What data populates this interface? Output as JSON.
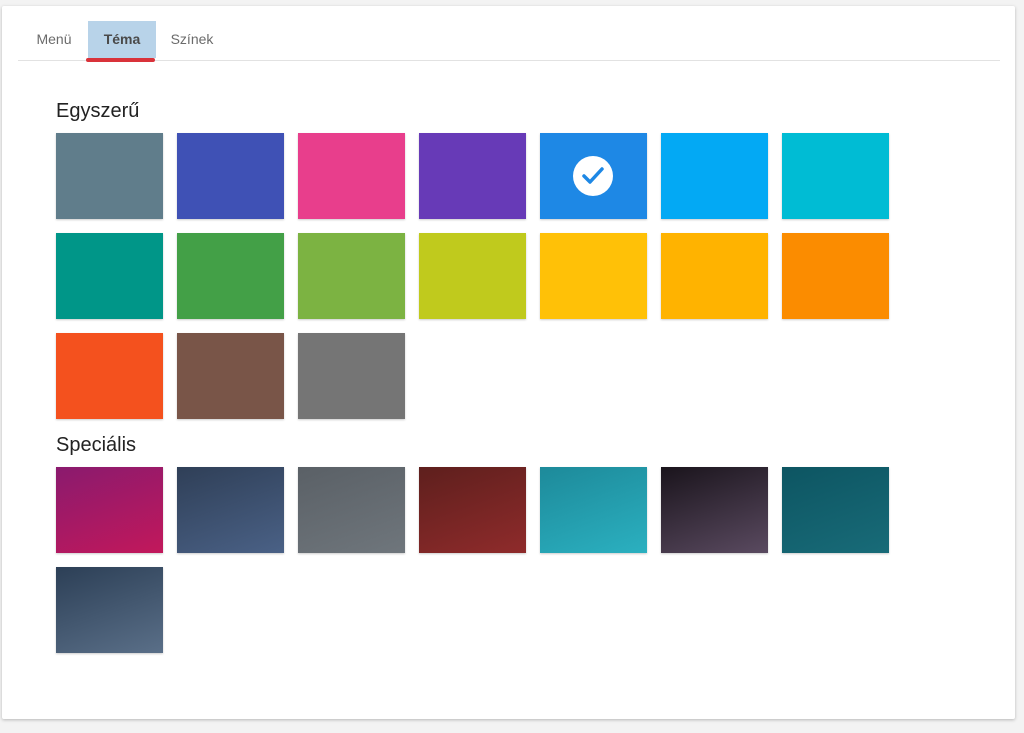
{
  "tabs": [
    {
      "label": "Menü",
      "active": false
    },
    {
      "label": "Téma",
      "active": true
    },
    {
      "label": "Színek",
      "active": false
    }
  ],
  "accent_underline_color": "#d9323a",
  "sections": {
    "simple": {
      "title": "Egyszerű",
      "selected_index": 4,
      "colors": [
        "#607d8b",
        "#3f51b5",
        "#e83e8c",
        "#673ab7",
        "#1e88e5",
        "#03a9f4",
        "#00bcd4",
        "#009688",
        "#43a047",
        "#7cb342",
        "#c0ca1d",
        "#ffc107",
        "#ffb300",
        "#fb8c00",
        "#f4511e",
        "#795548",
        "#757575"
      ]
    },
    "special": {
      "title": "Speciális",
      "themes": [
        {
          "name": "magenta-gradient",
          "colors": [
            "#8a1a6e",
            "#c2185b"
          ]
        },
        {
          "name": "stormy-sky",
          "colors": [
            "#2f3f57",
            "#4a6186"
          ]
        },
        {
          "name": "gray-pavement",
          "colors": [
            "#5a6066",
            "#6f767c"
          ]
        },
        {
          "name": "red-building",
          "colors": [
            "#5e1f1d",
            "#8f2b2b"
          ]
        },
        {
          "name": "turquoise-clouds",
          "colors": [
            "#1d8a9a",
            "#2bb0c0"
          ]
        },
        {
          "name": "night-lightning",
          "colors": [
            "#1a141c",
            "#5a4a60"
          ]
        },
        {
          "name": "teal-palm",
          "colors": [
            "#0d5562",
            "#186b78"
          ]
        },
        {
          "name": "gray-skyscraper",
          "colors": [
            "#2c3f56",
            "#5a6f88"
          ]
        }
      ]
    }
  }
}
